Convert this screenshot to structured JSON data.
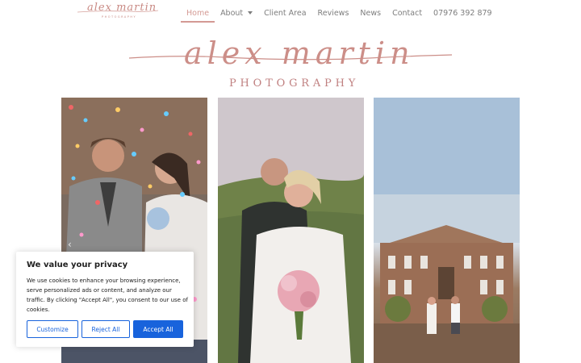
{
  "header": {
    "logo_script": "alex martin",
    "logo_sub": "PHOTOGRAPHY",
    "nav": [
      {
        "label": "Home",
        "active": true
      },
      {
        "label": "About",
        "has_dropdown": true
      },
      {
        "label": "Client Area"
      },
      {
        "label": "Reviews"
      },
      {
        "label": "News"
      },
      {
        "label": "Contact"
      },
      {
        "label": "07976 392 879"
      }
    ]
  },
  "hero": {
    "script": "alex martin",
    "sub": "PHOTOGRAPHY"
  },
  "photos": [
    {
      "subject": "couple-confetti"
    },
    {
      "subject": "bride-groom-embrace"
    },
    {
      "subject": "couple-stately-home"
    }
  ],
  "cookie": {
    "title": "We value your privacy",
    "text": "We use cookies to enhance your browsing experience, serve personalized ads or content, and analyze our traffic. By clicking \"Accept All\", you consent to our use of cookies.",
    "customize": "Customize",
    "reject": "Reject All",
    "accept": "Accept All"
  },
  "colors": {
    "brand": "#cc8e88",
    "nav_active": "#d49a94",
    "cookie_button": "#1863dc"
  }
}
